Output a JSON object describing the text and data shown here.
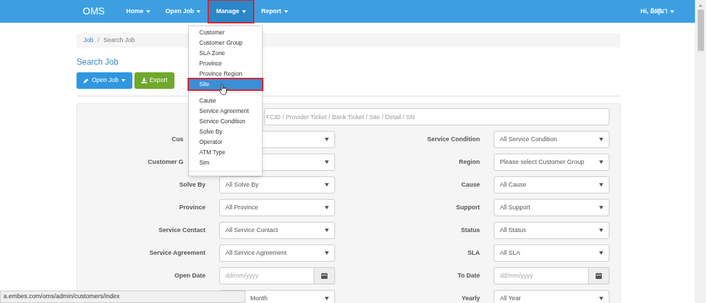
{
  "navbar": {
    "brand": "OMS",
    "items": [
      {
        "label": "Home",
        "selected": false,
        "highlighted": false
      },
      {
        "label": "Open Job",
        "selected": false,
        "highlighted": false
      },
      {
        "label": "Manage",
        "selected": true,
        "highlighted": true
      },
      {
        "label": "Report",
        "selected": false,
        "highlighted": false
      }
    ],
    "user": "Hi, อังสุมา"
  },
  "menu": {
    "items": [
      {
        "kind": "item",
        "label": "Customer",
        "selected": false,
        "highlighted": false
      },
      {
        "kind": "item",
        "label": "Customer Group",
        "selected": false,
        "highlighted": false
      },
      {
        "kind": "item",
        "label": "SLA Zone",
        "selected": false,
        "highlighted": false
      },
      {
        "kind": "item",
        "label": "Province",
        "selected": false,
        "highlighted": false
      },
      {
        "kind": "item",
        "label": "Province Region",
        "selected": false,
        "highlighted": false
      },
      {
        "kind": "item",
        "label": "Site",
        "selected": true,
        "highlighted": true
      },
      {
        "kind": "divider"
      },
      {
        "kind": "item",
        "label": "Cause",
        "selected": false,
        "highlighted": false
      },
      {
        "kind": "item",
        "label": "Service Agreement",
        "selected": false,
        "highlighted": false
      },
      {
        "kind": "item",
        "label": "Service Condition",
        "selected": false,
        "highlighted": false
      },
      {
        "kind": "item",
        "label": "Solve By",
        "selected": false,
        "highlighted": false
      },
      {
        "kind": "item",
        "label": "Operator",
        "selected": false,
        "highlighted": false
      },
      {
        "kind": "item",
        "label": "ATM Type",
        "selected": false,
        "highlighted": false
      },
      {
        "kind": "item",
        "label": "Sim",
        "selected": false,
        "highlighted": false
      },
      {
        "kind": "divider"
      }
    ]
  },
  "breadcrumb": [
    {
      "label": "Job",
      "link": true
    },
    {
      "label": "Search Job",
      "link": false
    }
  ],
  "breadcrumb_separator": "/",
  "title": "Search Job",
  "buttons": [
    {
      "kind": "primary",
      "label": "Open Job",
      "caret": true
    },
    {
      "kind": "success",
      "label": "Export",
      "caret": false
    }
  ],
  "search": {
    "placeholder": "FCID / Provider Ticket / Bank Ticket / Site / Detail / SN"
  },
  "rows": [
    [
      {
        "label": "Cus",
        "label_cut": true,
        "kind": "select"
      },
      {
        "label": "Service Condition",
        "kind": "select",
        "value": "All Service Condition"
      }
    ],
    [
      {
        "label": "Customer G",
        "label_cut": true,
        "kind": "select"
      },
      {
        "label": "Region",
        "kind": "select",
        "value": "Please select Customer Group"
      }
    ],
    [
      {
        "label": "Solve By",
        "kind": "select",
        "value": "All Solve By"
      },
      {
        "label": "Cause",
        "kind": "select",
        "value": "All Cause"
      }
    ],
    [
      {
        "label": "Province",
        "kind": "select",
        "value": "All Province"
      },
      {
        "label": "Support",
        "kind": "select",
        "value": "All Support"
      }
    ],
    [
      {
        "label": "Service Contact",
        "kind": "select",
        "value": "All Service Contact"
      },
      {
        "label": "Status",
        "kind": "select",
        "value": "All Status"
      }
    ],
    [
      {
        "label": "Service Agreement",
        "kind": "select",
        "value": "All Service Agreement"
      },
      {
        "label": "SLA",
        "kind": "select",
        "value": "All SLA"
      }
    ],
    [
      {
        "label": "Open Date",
        "kind": "date",
        "placeholder": "dd/mm/yyyy"
      },
      {
        "label": "To Date",
        "kind": "date",
        "placeholder": "dd/mm/yyyy"
      }
    ],
    [
      {
        "kind": "select",
        "value": "Month",
        "value_cut": true
      },
      {
        "label": "Yearly",
        "kind": "select",
        "value": "All Year"
      }
    ]
  ],
  "status_bar": "a.embes.com/oms/admin/customers/index"
}
